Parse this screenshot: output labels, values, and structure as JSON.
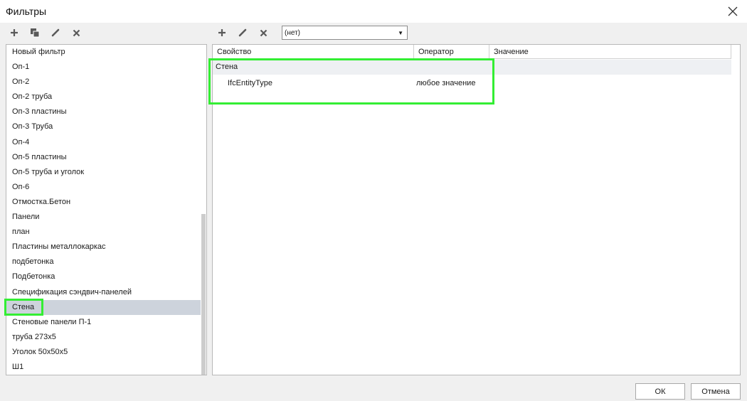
{
  "window": {
    "title": "Фильтры"
  },
  "left_toolbar": {
    "icons": [
      "add-icon",
      "copy-icon",
      "edit-icon",
      "delete-icon"
    ]
  },
  "right_toolbar": {
    "icons": [
      "add-icon",
      "edit-icon",
      "delete-icon"
    ],
    "combo_value": "(нет)"
  },
  "filters": {
    "items": [
      "Новый фильтр",
      "Оп-1",
      "Оп-2",
      "Оп-2 труба",
      "Оп-3 пластины",
      "Оп-3 Труба",
      "Оп-4",
      "Оп-5 пластины",
      "Оп-5 труба и уголок",
      "Оп-6",
      "Отмостка.Бетон",
      "Панели",
      "план",
      "Пластины металлокаркас",
      "подбетонка",
      "Подбетонка",
      "Спецификация сэндвич-панелей",
      "Стена",
      "Стеновые панели П-1",
      "труба 273x5",
      "Уголок 50x50x5",
      "Ш1"
    ],
    "selected": "Стена"
  },
  "grid": {
    "columns": [
      "Свойство",
      "Оператор",
      "Значение"
    ],
    "group": "Стена",
    "rows": [
      {
        "property": "IfcEntityType",
        "operator": "любое значение",
        "value": ""
      }
    ]
  },
  "buttons": {
    "ok": "ОК",
    "cancel": "Отмена"
  },
  "colors": {
    "highlight": "#33ee33",
    "selection": "#cdd3dc",
    "icon": "#5a5a5a"
  }
}
